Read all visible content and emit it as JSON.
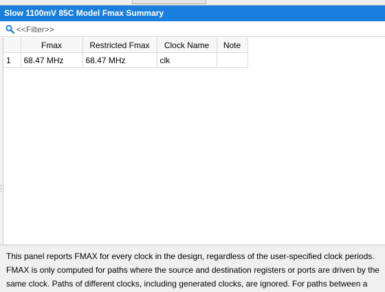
{
  "panel": {
    "title": "Slow 1100mV 85C Model Fmax Summary"
  },
  "filter": {
    "placeholder": "<<Filter>>",
    "value": ""
  },
  "table": {
    "columns": [
      "",
      "Fmax",
      "Restricted Fmax",
      "Clock Name",
      "Note"
    ],
    "rows": [
      {
        "index": "1",
        "fmax": "68.47 MHz",
        "restricted_fmax": "68.47 MHz",
        "clock_name": "clk",
        "note": ""
      }
    ]
  },
  "description": {
    "text": "This panel reports FMAX for every clock in the design, regardless of the user-specified clock periods. FMAX is only computed for paths where the source and destination registers or ports are driven by the same clock.  Paths of different clocks, including generated clocks, are ignored.  For paths between a"
  },
  "colors": {
    "title_bar": "#1a7fdc",
    "title_text": "#ffffff",
    "description_bg": "#f0f0f0",
    "search_icon": "#1a7fdc"
  },
  "icons": {
    "search": "search-icon"
  }
}
